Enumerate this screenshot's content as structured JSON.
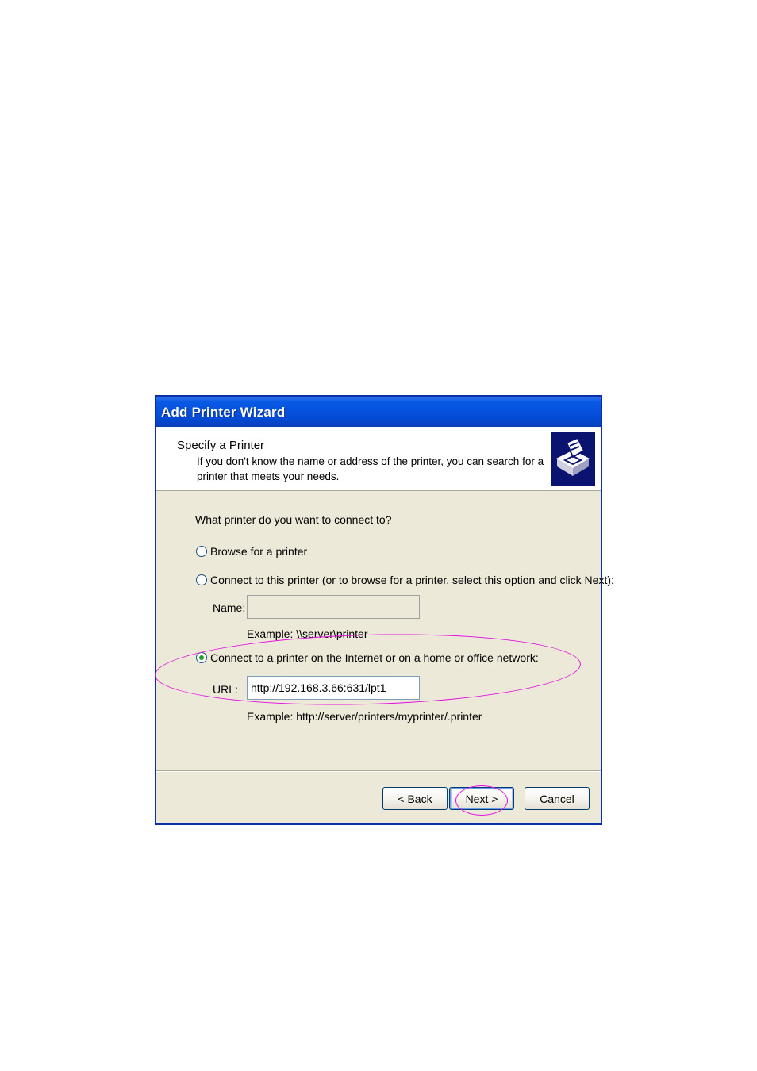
{
  "window": {
    "title": "Add Printer Wizard"
  },
  "header": {
    "title": "Specify a Printer",
    "description": "If you don't know the name or address of the printer, you can search for a printer that meets your needs.",
    "icon": "printer-wizard-icon"
  },
  "main": {
    "prompt": "What printer do you want to connect to?",
    "options": [
      {
        "label": "Browse for a printer",
        "selected": false
      },
      {
        "label": "Connect to this printer (or to browse for a printer, select this option and click Next):",
        "selected": false
      },
      {
        "label": "Connect to a printer on the Internet or on a home or office network:",
        "selected": true
      }
    ],
    "name_field": {
      "label": "Name:",
      "value": "",
      "example": "Example: \\\\server\\printer"
    },
    "url_field": {
      "label": "URL:",
      "value": "http://192.168.3.66:631/lpt1",
      "example": "Example: http://server/printers/myprinter/.printer"
    }
  },
  "buttons": {
    "back": "< Back",
    "next": "Next >",
    "cancel": "Cancel"
  },
  "colors": {
    "titlebar": "#0550dc",
    "annotation": "#e30fe0",
    "dialog_bg": "#ece9d8"
  }
}
